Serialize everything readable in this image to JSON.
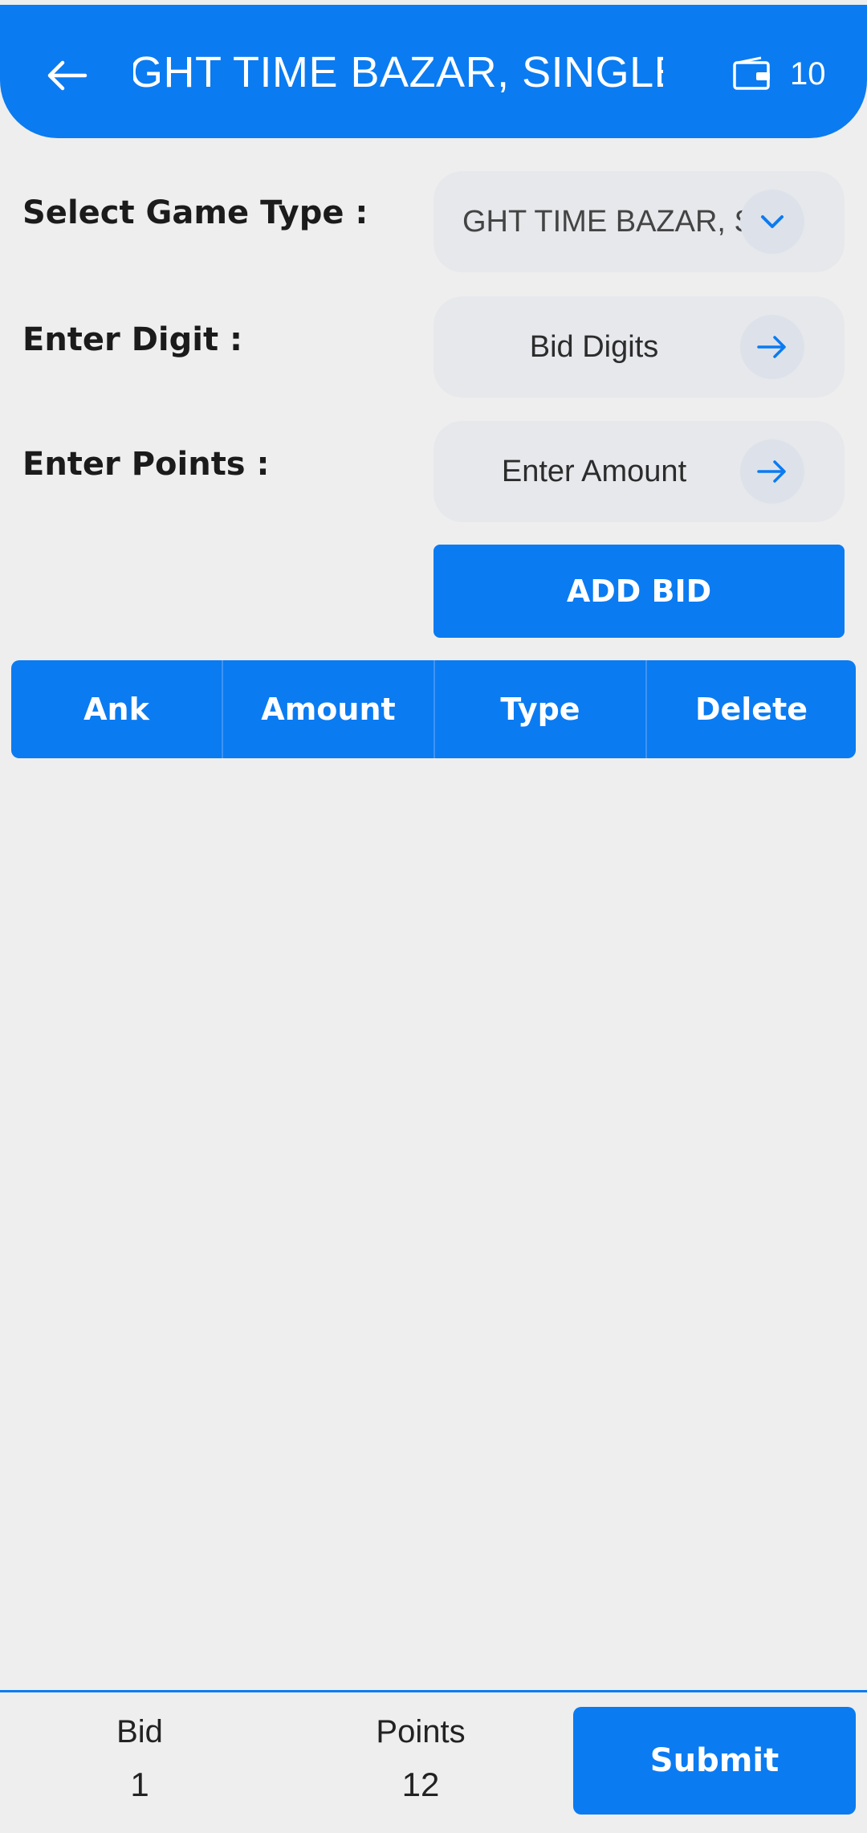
{
  "header": {
    "title": "NIGHT TIME BAZAR, SINGLE",
    "wallet_balance": "10"
  },
  "form": {
    "game_type": {
      "label": "Select Game Type :",
      "value": "NIGHT TIME BAZAR, SINGLE"
    },
    "digit": {
      "label": "Enter Digit :",
      "placeholder": "Bid Digits"
    },
    "points": {
      "label": "Enter Points :",
      "placeholder": "Enter Amount"
    },
    "add_bid_label": "ADD BID"
  },
  "table": {
    "columns": [
      "Ank",
      "Amount",
      "Type",
      "Delete"
    ]
  },
  "footer": {
    "bid_label": "Bid",
    "bid_value": "1",
    "points_label": "Points",
    "points_value": "12",
    "submit_label": "Submit"
  },
  "colors": {
    "primary": "#0b7bf1",
    "background": "#eeeeee",
    "field_background": "#e6e8ec"
  }
}
